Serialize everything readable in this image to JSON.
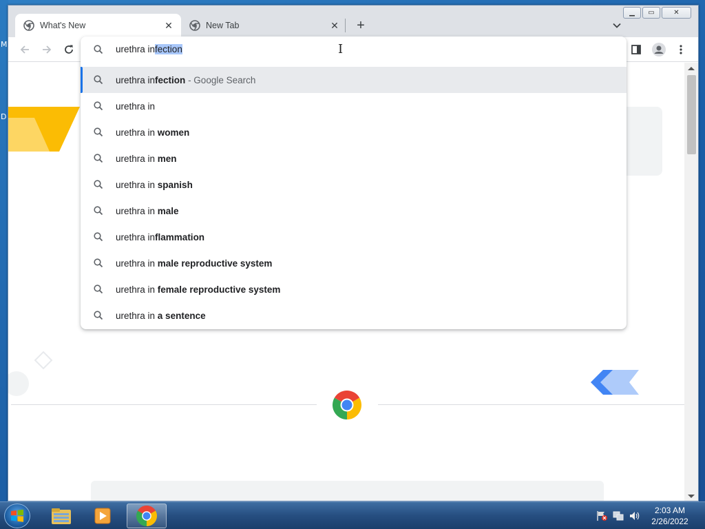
{
  "desktop": {
    "edge_letters": [
      "M",
      "D"
    ]
  },
  "tabs": [
    {
      "title": "What's New",
      "active": true
    },
    {
      "title": "New Tab",
      "active": false
    }
  ],
  "window_controls": {
    "minimize": "▁",
    "maximize": "▭",
    "close": "✕"
  },
  "omnibox": {
    "typed": "urethra in",
    "autocompleted": "fection",
    "suggestions": [
      {
        "prefix": "urethra in",
        "bold": "fection",
        "suffix": " - Google Search",
        "selected": true
      },
      {
        "prefix": "urethra in",
        "bold": "",
        "suffix": ""
      },
      {
        "prefix": "urethra in ",
        "bold": "women",
        "suffix": ""
      },
      {
        "prefix": "urethra in ",
        "bold": "men",
        "suffix": ""
      },
      {
        "prefix": "urethra in ",
        "bold": "spanish",
        "suffix": ""
      },
      {
        "prefix": "urethra in ",
        "bold": "male",
        "suffix": ""
      },
      {
        "prefix": "urethra in",
        "bold": "flammation",
        "suffix": ""
      },
      {
        "prefix": "urethra in ",
        "bold": "male reproductive system",
        "suffix": ""
      },
      {
        "prefix": "urethra in ",
        "bold": "female reproductive system",
        "suffix": ""
      },
      {
        "prefix": "urethra in ",
        "bold": "a sentence",
        "suffix": ""
      }
    ]
  },
  "taskbar": {
    "time": "2:03 AM",
    "date": "2/26/2022"
  },
  "colors": {
    "accent": "#1a73e8",
    "selection": "#a8c7fa",
    "suggestion_selected_bg": "#e8eaed"
  }
}
